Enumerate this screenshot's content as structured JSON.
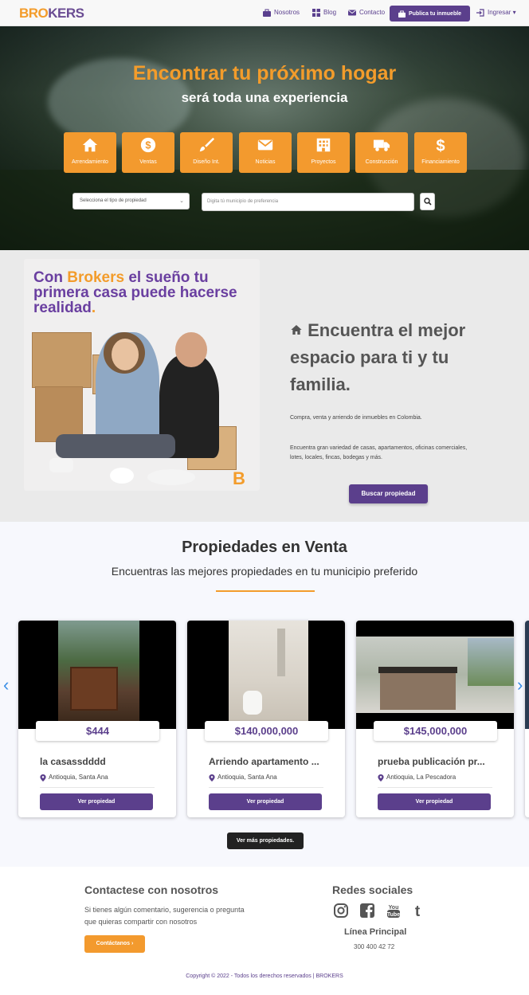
{
  "brand": {
    "logo_part1": "BRO",
    "logo_part2": "KERS"
  },
  "nav": {
    "links": [
      {
        "label": "Nosotros",
        "icon": "briefcase-icon"
      },
      {
        "label": "Blog",
        "icon": "grid-icon"
      },
      {
        "label": "Contacto",
        "icon": "envelope-icon"
      }
    ],
    "publish_label": "Publica tu inmueble",
    "login_label": "Ingresar ▾"
  },
  "hero": {
    "title": "Encontrar tu próximo hogar",
    "subtitle": "será toda una experiencia",
    "categories": [
      {
        "label": "Arrendamiento",
        "icon": "home-icon"
      },
      {
        "label": "Ventas",
        "icon": "dollar-circle-icon"
      },
      {
        "label": "Diseño Int.",
        "icon": "paintbrush-icon"
      },
      {
        "label": "Noticias",
        "icon": "envelope-icon"
      },
      {
        "label": "Proyectos",
        "icon": "building-icon"
      },
      {
        "label": "Construcción",
        "icon": "truck-icon"
      },
      {
        "label": "Financiamiento",
        "icon": "dollar-icon"
      }
    ],
    "type_select_value": "Selecciona el tipo de propiedad",
    "municipio_placeholder": "Digita tú municipio de preferencia"
  },
  "about": {
    "promo_prefix": "Con ",
    "promo_brand": "Brokers",
    "promo_rest": " el sueño tu primera casa puede hacerse realidad",
    "promo_dot": ".",
    "promo_mark": "B",
    "heading": "Encuentra el mejor espacio para ti y tu familia.",
    "paragraph1": "Compra, venta y arriendo de inmuebles en Colombia.",
    "paragraph2": "Encuentra gran variedad de casas, apartamentos, oficinas comerciales, lotes, locales, fincas, bodegas y más.",
    "button_label": "Buscar propiedad"
  },
  "listings": {
    "title": "Propiedades en Venta",
    "subtitle": "Encuentras las mejores propiedades en tu municipio preferido",
    "prev_arrow": "‹",
    "next_arrow": "›",
    "cards": [
      {
        "price": "$444",
        "title": "la casassdddd",
        "location": "Antioquia, Santa Ana",
        "button": "Ver propiedad"
      },
      {
        "price": "$140,000,000",
        "title": "Arriendo apartamento ...",
        "location": "Antioquia, Santa Ana",
        "button": "Ver propiedad"
      },
      {
        "price": "$145,000,000",
        "title": "prueba publicación pr...",
        "location": "Antioquia, La Pescadora",
        "button": "Ver propiedad"
      }
    ],
    "more_button": "Ver más propiedades."
  },
  "footer": {
    "contact_title": "Contactese con nosotros",
    "contact_text": "Si tienes algún comentario, sugerencia o pregunta que quieras compartir con nosotros",
    "contact_button": "Contáctanos ›",
    "social_title": "Redes sociales",
    "social_icons": [
      "instagram-icon",
      "facebook-icon",
      "youtube-icon",
      "tumblr-icon"
    ],
    "youtube_you": "You",
    "youtube_tube": "Tube",
    "tumblr_letter": "t",
    "line_title": "Línea Principal",
    "line_phone": "300 400 42 72",
    "copyright": "Copyright © 2022 - Todos los derechos reservados | BROKERS"
  },
  "colors": {
    "orange": "#f39a2e",
    "purple": "#5b3f8c",
    "arrow_blue": "#3a8ee6"
  }
}
